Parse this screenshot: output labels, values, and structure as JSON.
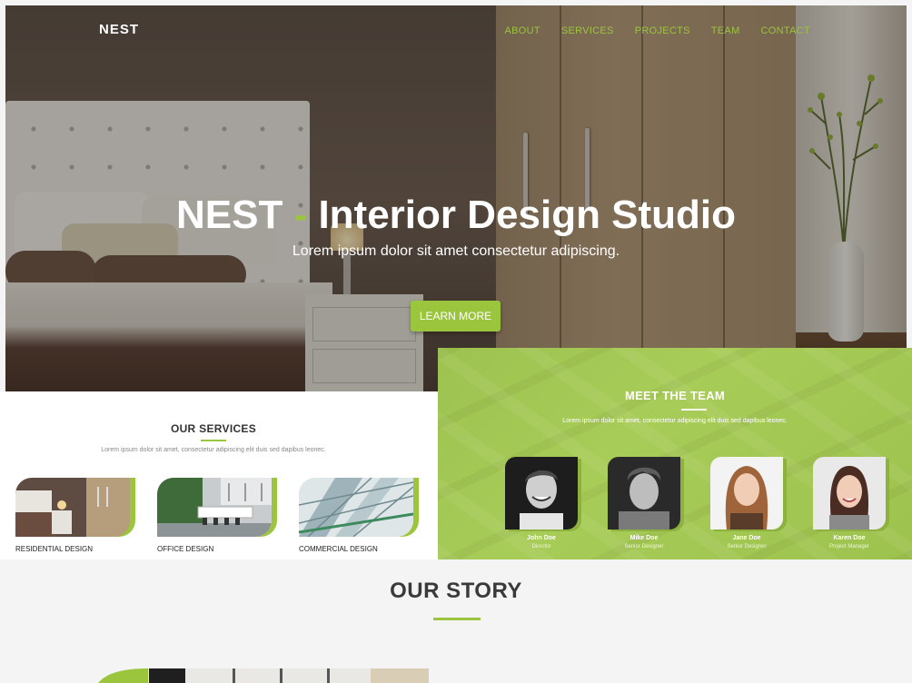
{
  "nav": {
    "logo": "NEST",
    "items": [
      "ABOUT",
      "SERVICES",
      "PROJECTS",
      "TEAM",
      "CONTACT"
    ]
  },
  "hero": {
    "title_brand": "NEST",
    "title_dash": "-",
    "title_rest": "Interior Design Studio",
    "subtitle": "Lorem ipsum dolor sit amet consectetur adipiscing.",
    "button_label": "LEARN MORE"
  },
  "services": {
    "heading": "OUR SERVICES",
    "lead": "Lorem ipsum dolor sit amet, consectetur adipiscing elit duis sed dapibus leonec.",
    "items": [
      {
        "label": "RESIDENTIAL DESIGN"
      },
      {
        "label": "OFFICE DESIGN"
      },
      {
        "label": "COMMERCIAL DESIGN"
      }
    ]
  },
  "team": {
    "heading": "MEET THE TEAM",
    "lead": "Lorem ipsum dolor sit amet, consectetur adipiscing elit duis sed dapibus leonec.",
    "members": [
      {
        "name": "John Doe",
        "role": "Director"
      },
      {
        "name": "Mike Doe",
        "role": "Senior Designer"
      },
      {
        "name": "Jane Doe",
        "role": "Senior Designer"
      },
      {
        "name": "Karen Doe",
        "role": "Project Manager"
      }
    ]
  },
  "story": {
    "heading": "OUR STORY"
  },
  "colors": {
    "accent": "#9bc53d",
    "team_bg": "#a3c755",
    "text_dark": "#3a3a3a"
  }
}
